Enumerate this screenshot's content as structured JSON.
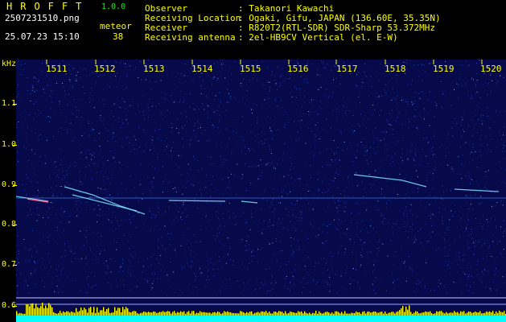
{
  "app": {
    "title": "HROFFT",
    "version": "1.0.0"
  },
  "file_name": "2507231510.png",
  "date_time": "25.07.23 15:10",
  "meteor": {
    "label": "meteor",
    "count": "38"
  },
  "info": [
    {
      "label": "Observer",
      "value": ": Takanori Kawachi"
    },
    {
      "label": "Receiving Location",
      "value": ": Ogaki, Gifu, JAPAN (136.60E, 35.35N)"
    },
    {
      "label": "Receiver",
      "value": ": R820T2(RTL-SDR) SDR-Sharp 53.372MHz"
    },
    {
      "label": "Receiving antenna",
      "value": ": 2el-HB9CV Vertical (el. E-W)"
    }
  ],
  "axis": {
    "y_unit": "kHz",
    "y_ticks": [
      "1.1",
      "1.0",
      "0.9",
      "0.8",
      "0.7",
      "0.6"
    ],
    "x_ticks": [
      "1511",
      "1512",
      "1513",
      "1514",
      "1515",
      "1516",
      "1517",
      "1518",
      "1519",
      "1520"
    ]
  },
  "colors": {
    "background": "#060a4a",
    "text_yellow": "#ffff00",
    "text_green": "#00ff00",
    "trail": "#7fe7ff",
    "level": "#ffff00",
    "baseline": "#00ffff"
  }
}
